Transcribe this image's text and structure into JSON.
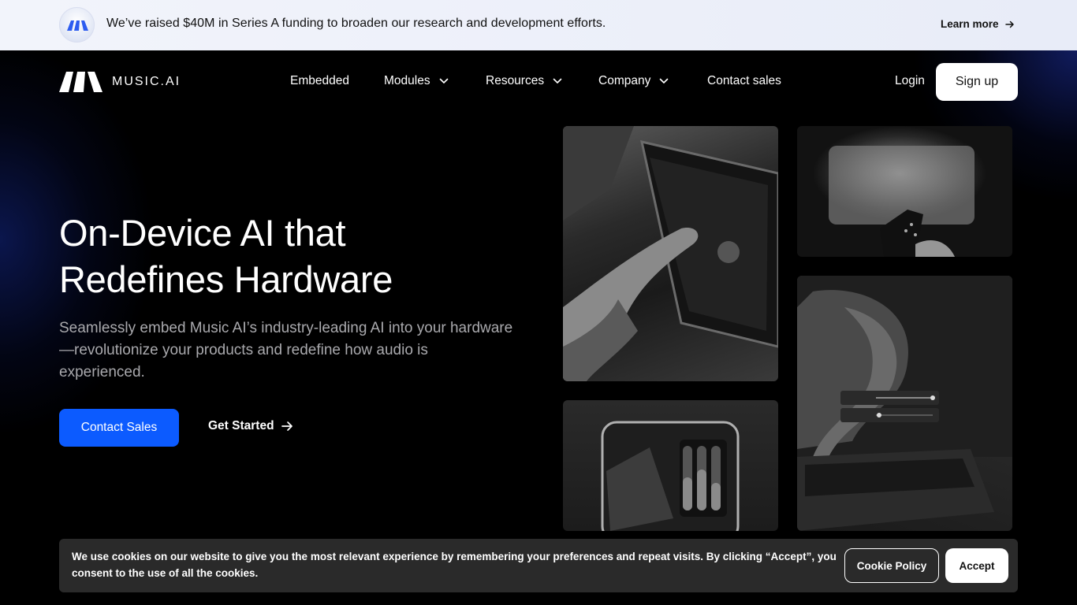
{
  "announcement": {
    "message": "We’ve raised $40M in Series A funding to broaden our research and development efforts.",
    "link_label": "Learn more"
  },
  "brand": {
    "name": "MUSIC.AI"
  },
  "nav": {
    "items": [
      {
        "label": "Embedded",
        "has_dropdown": false
      },
      {
        "label": "Modules",
        "has_dropdown": true
      },
      {
        "label": "Resources",
        "has_dropdown": true
      },
      {
        "label": "Company",
        "has_dropdown": true
      },
      {
        "label": "Contact sales",
        "has_dropdown": false
      }
    ],
    "login_label": "Login",
    "signup_label": "Sign up"
  },
  "hero": {
    "headline_line1": "On-Device AI that",
    "headline_line2": "Redefines Hardware",
    "subtext": "Seamlessly embed Music AI’s industry-leading AI into your hardware—revolutionize your products and redefine how audio is experienced.",
    "primary_cta": "Contact Sales",
    "secondary_cta": "Get Started"
  },
  "cookie_banner": {
    "text": "We use cookies on our website to give you the most relevant experience by remembering your preferences and repeat visits. By clicking “Accept”, you consent to the use of all the cookies.",
    "policy_label": "Cookie Policy",
    "accept_label": "Accept"
  },
  "colors": {
    "primary_blue": "#0c5bff",
    "announcement_bg": "#eef1fa",
    "cookie_bg": "#2a2a2a"
  }
}
